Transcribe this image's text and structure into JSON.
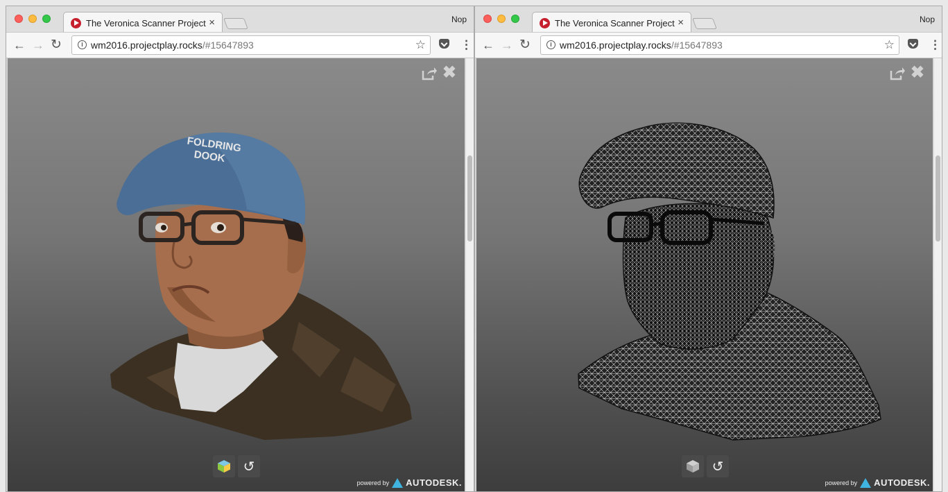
{
  "windows": [
    {
      "tab_title": "The Veronica Scanner Project",
      "tab_close": "×",
      "profile_name": "Nop",
      "url_host": "wm2016.projectplay.rocks",
      "url_path": "/#15647893",
      "viewer": {
        "close_glyph": "✖",
        "cap_text_line1": "FOLDRING",
        "cap_text_line2": "DOOK",
        "powered_by": "powered by",
        "brand": "AUTODESK."
      }
    },
    {
      "tab_title": "The Veronica Scanner Project",
      "tab_close": "×",
      "profile_name": "Nop",
      "url_host": "wm2016.projectplay.rocks",
      "url_path": "/#15647893",
      "viewer": {
        "close_glyph": "✖",
        "powered_by": "powered by",
        "brand": "AUTODESK."
      }
    }
  ],
  "icons": {
    "back": "←",
    "forward": "→",
    "reload": "↻",
    "star": "☆",
    "menu": "⋮",
    "reset": "↺"
  },
  "colors": {
    "autodesk_blue": "#3fb4e0",
    "favicon_red": "#c61f2d"
  }
}
